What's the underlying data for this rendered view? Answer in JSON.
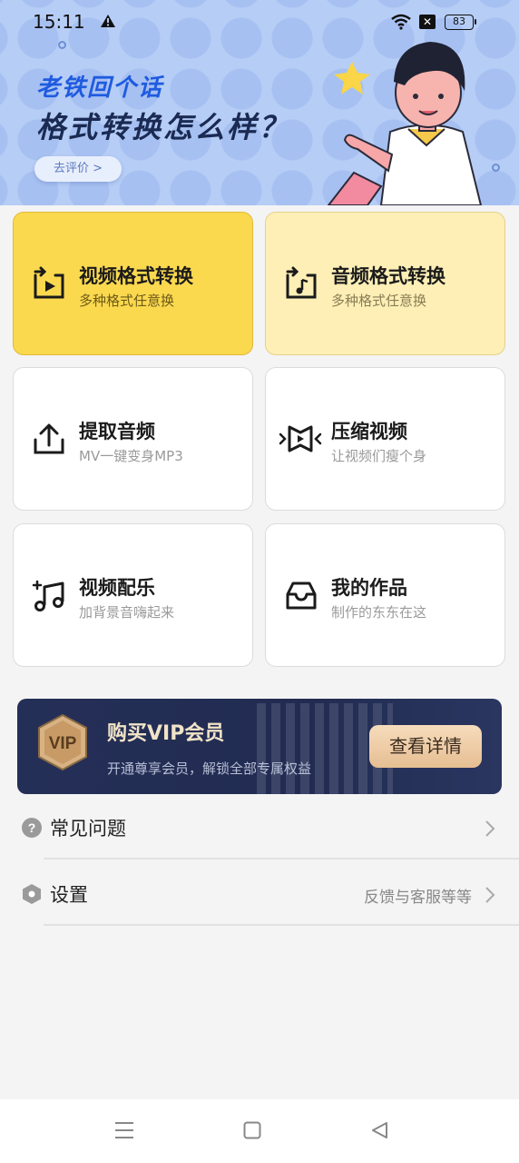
{
  "status_bar": {
    "time": "15:11",
    "battery": "83"
  },
  "banner": {
    "line1": "老铁回个话",
    "line2": "格式转换怎么样？",
    "rate_button": "去评价 >"
  },
  "features": [
    {
      "title": "视频格式转换",
      "subtitle": "多种格式任意换",
      "icon": "video-convert-icon"
    },
    {
      "title": "音频格式转换",
      "subtitle": "多种格式任意换",
      "icon": "audio-convert-icon"
    },
    {
      "title": "提取音频",
      "subtitle": "MV一键变身MP3",
      "icon": "upload-icon"
    },
    {
      "title": "压缩视频",
      "subtitle": "让视频们瘦个身",
      "icon": "compress-icon"
    },
    {
      "title": "视频配乐",
      "subtitle": "加背景音嗨起来",
      "icon": "music-add-icon"
    },
    {
      "title": "我的作品",
      "subtitle": "制作的东东在这",
      "icon": "inbox-icon"
    }
  ],
  "vip": {
    "badge": "VIP",
    "title": "购买VIP会员",
    "subtitle": "开通尊享会员，解锁全部专属权益",
    "button": "查看详情"
  },
  "menu": [
    {
      "label": "常见问题",
      "hint": ""
    },
    {
      "label": "设置",
      "hint": "反馈与客服等等"
    }
  ],
  "colors": {
    "accent_yellow": "#fbd94f",
    "soft_yellow": "#fdefb6",
    "banner_blue": "#b6cdf6",
    "vip_navy": "#242f57"
  }
}
